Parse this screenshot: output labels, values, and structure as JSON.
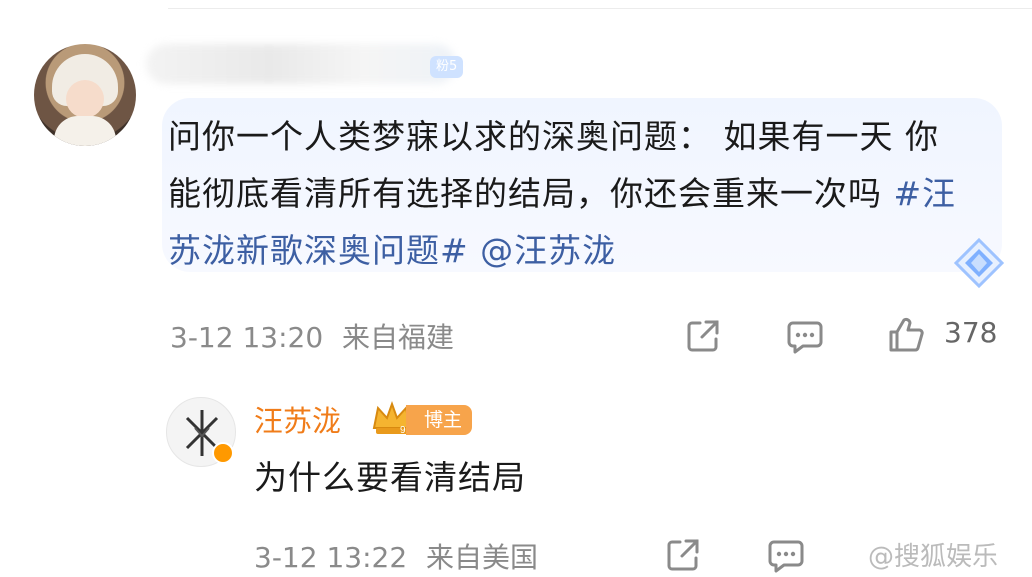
{
  "main_comment": {
    "fan_badge": "粉5",
    "text": "问你一个人类梦寐以求的深奥问题： 如果有一天 你能彻底看清所有选择的结局，你还会重来一次吗 ",
    "hashtag": "#汪苏泷新歌深奥问题#",
    "mention": "@汪苏泷",
    "timestamp": "3-12 13:20",
    "location": "来自福建",
    "like_count": "378"
  },
  "reply": {
    "author": "汪苏泷",
    "badge_level": "9",
    "badge_label": "博主",
    "text": "为什么要看清结局",
    "timestamp": "3-12 13:22",
    "location": "来自美国"
  },
  "watermark": "搜狐娱乐",
  "colors": {
    "link": "#3d5fa3",
    "author": "#f07c19",
    "badge": "#f7a44b",
    "bubble": "#f0f5ff",
    "meta": "#8a8a8a"
  },
  "icons": [
    "share-icon",
    "comment-icon",
    "like-icon",
    "diamond-icon",
    "crown-icon",
    "verified-icon"
  ]
}
